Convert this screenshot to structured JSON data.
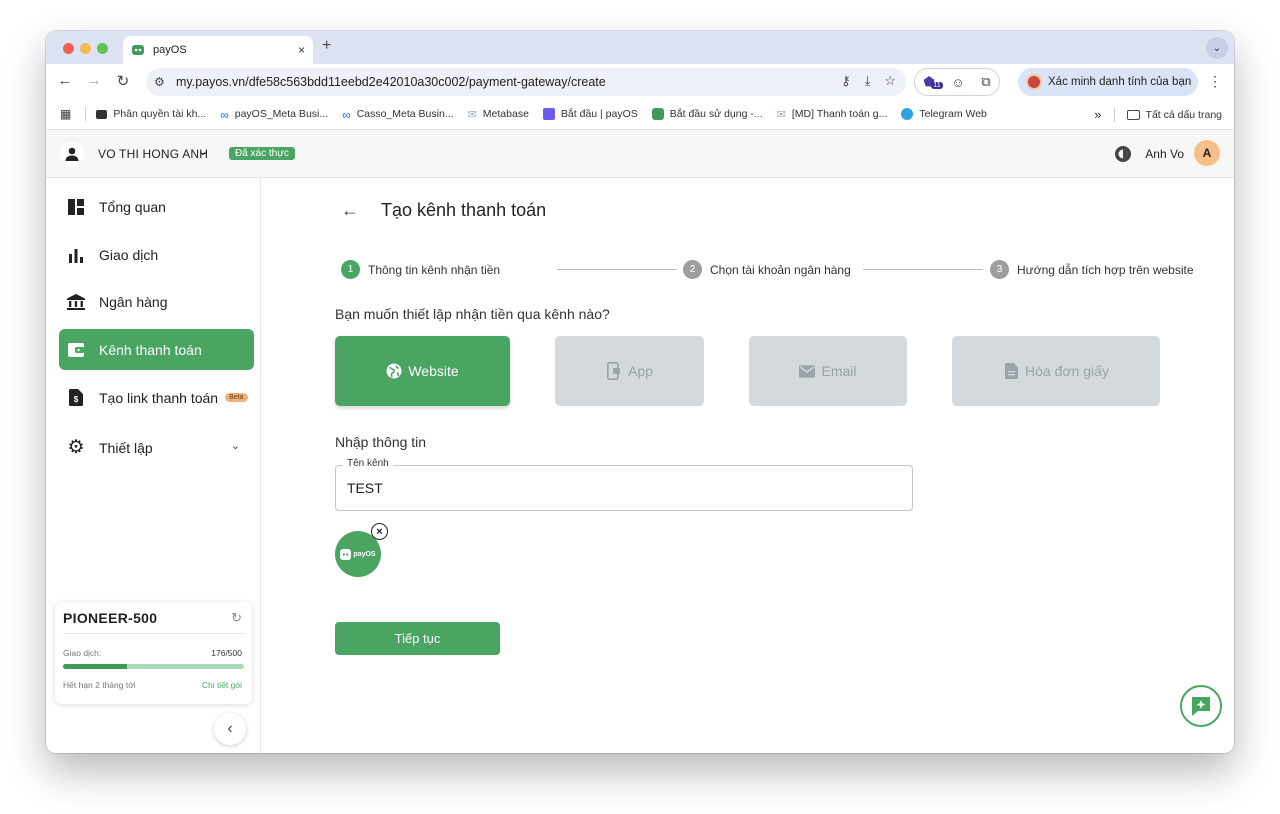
{
  "browser": {
    "tab_title": "payOS",
    "tab_close": "×",
    "new_tab": "+",
    "url": "my.payos.vn/dfe58c563bdd11eebd2e42010a30c002/payment-gateway/create",
    "extension_badge": "11",
    "profile_label": "Xác minh danh tính của bạn",
    "bookmarks": [
      "Phân quyền tài kh...",
      "payOS_Meta Busi...",
      "Casso_Meta Busin...",
      "Metabase",
      "Bắt đầu | payOS",
      "Bắt đầu sử dụng -...",
      "[MD] Thanh toán g...",
      "Telegram Web"
    ],
    "bookmarks_more": "»",
    "all_bookmarks": "Tất cả dấu trang"
  },
  "header": {
    "user_name": "VO THI HONG ANH",
    "verified_badge": "Đã xác thực",
    "account_name": "Anh Vo",
    "avatar_letter": "A"
  },
  "sidebar": {
    "items": [
      {
        "label": "Tổng quan"
      },
      {
        "label": "Giao dịch"
      },
      {
        "label": "Ngân hàng"
      },
      {
        "label": "Kênh thanh toán"
      },
      {
        "label": "Tạo link thanh toán",
        "badge": "Beta"
      },
      {
        "label": "Thiết lập"
      }
    ],
    "plan": {
      "name": "PIONEER-500",
      "usage_label": "Giao dịch:",
      "usage_count": "176/500",
      "usage_fraction": 0.352,
      "expiry": "Hết hạn 2 tháng tới",
      "detail_link": "Chi tiết gói"
    }
  },
  "main": {
    "title": "Tạo kênh thanh toán",
    "steps": [
      {
        "num": "1",
        "label": "Thông tin kênh nhận tiền"
      },
      {
        "num": "2",
        "label": "Chọn tài khoản ngân hàng"
      },
      {
        "num": "3",
        "label": "Hướng dẫn tích hợp trên website"
      }
    ],
    "question": "Bạn muốn thiết lập nhận tiền qua kênh nào?",
    "channels": [
      {
        "label": "Website"
      },
      {
        "label": "App"
      },
      {
        "label": "Email"
      },
      {
        "label": "Hóa đơn giấy"
      }
    ],
    "info_heading": "Nhập thông tin",
    "channel_name_label": "Tên kênh",
    "channel_name_value": "TEST",
    "logo_text": "payOS",
    "continue_label": "Tiếp tục"
  },
  "colors": {
    "accent": "#4aa563",
    "inactive_channel": "#d3d9dc",
    "step_inactive": "#9e9e9e"
  }
}
